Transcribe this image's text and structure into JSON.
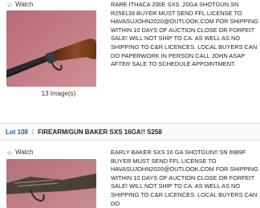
{
  "listing1": {
    "watch_label": "Watch",
    "image_count": "13 Image(s)",
    "description": "RARE ITHACA 200E SXS .20GA SHOTGUN SN R258139 BUYER MUST SEND FFL LICENSE TO HAVASUJOHN2020@OUTLOOK.COM FOR SHIPPING WITHIN 10 DAYS OF AUCTION CLOSE OR FORFEIT SALE! WILL NOT SHIP TO CA. AS WELL AS NO SHIPPING TO C&R LICENCES. LOCAL BUYERS CAN DO PAPERWORK IN PERSON CALL JOHN ASAP AFTER SALE TO SCHEDULE APPOINTMENT."
  },
  "lot_header": {
    "lot_label": "Lot 108",
    "separator": "|",
    "title": "FIREARM/GUN BAKER SXS 16GA!! S258"
  },
  "listing2": {
    "watch_label": "Watch",
    "description": "EARLY BAKER SXS 16 GA SHOTGUN!! SN 6989F BUYER MUST SEND FFL LICENSE TO HAVASUJOHN2020@OUTLOOK.COM FOR SHIPPING WITHIN 10 DAYS OF AUCTION CLOSE OR FORFEIT SALE! WILL NOT SHIP TO CA. AS WELL AS NO SHIPPING TO C&R LICENCES. LOCAL BUYERS CAN DO"
  },
  "icons": {
    "watch": "star-outline-icon",
    "photo": "shotgun-photo"
  },
  "colors": {
    "lot_number": "#1a5fa8",
    "photo_background": "#c07880"
  }
}
